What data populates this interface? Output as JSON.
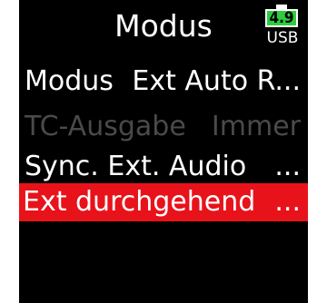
{
  "screen": {
    "title": "Modus",
    "battery_level": "4.9",
    "power_source": "USB"
  },
  "menu": {
    "items": [
      {
        "label": "Modus",
        "value": "Ext Auto R...",
        "enabled": true,
        "selected": false
      },
      {
        "label": "TC-Ausgabe",
        "value": "Immer",
        "enabled": false,
        "selected": false
      },
      {
        "label": "Sync. Ext. Audio",
        "value": "...",
        "enabled": true,
        "selected": false
      },
      {
        "label": "Ext durchgehend",
        "value": "...",
        "enabled": true,
        "selected": true
      }
    ]
  },
  "colors": {
    "background": "#000000",
    "selection": "#e8121b",
    "battery": "#2ecc40",
    "disabled_text": "#4a4a4a"
  }
}
